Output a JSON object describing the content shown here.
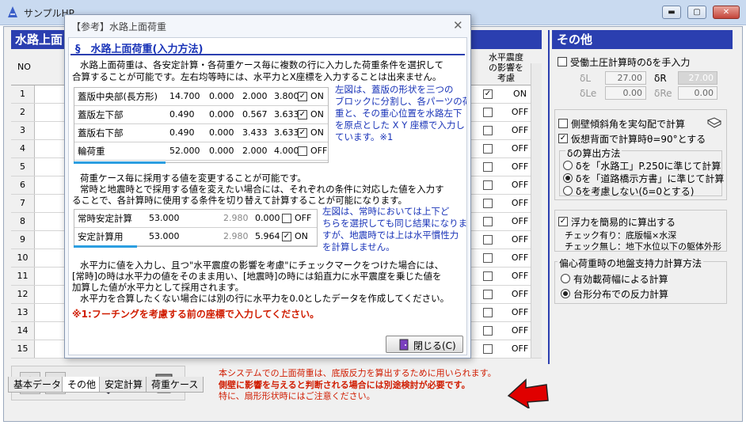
{
  "window": {
    "title": "サンプルHP"
  },
  "left_panel": {
    "title": "水路上面",
    "col_no": "NO",
    "col_seismic": "水平震度の影響を考慮",
    "rows": [
      {
        "no": "1",
        "val": "ON",
        "checked": true
      },
      {
        "no": "2",
        "val": "OFF",
        "checked": false
      },
      {
        "no": "3",
        "val": "OFF",
        "checked": false
      },
      {
        "no": "4",
        "val": "OFF",
        "checked": false
      },
      {
        "no": "5",
        "val": "OFF",
        "checked": false
      },
      {
        "no": "6",
        "val": "OFF",
        "checked": false
      },
      {
        "no": "7",
        "val": "OFF",
        "checked": false
      },
      {
        "no": "8",
        "val": "OFF",
        "checked": false
      },
      {
        "no": "9",
        "val": "OFF",
        "checked": false
      },
      {
        "no": "10",
        "val": "OFF",
        "checked": false
      },
      {
        "no": "11",
        "val": "OFF",
        "checked": false
      },
      {
        "no": "12",
        "val": "OFF",
        "checked": false
      },
      {
        "no": "13",
        "val": "OFF",
        "checked": false
      },
      {
        "no": "14",
        "val": "OFF",
        "checked": false
      },
      {
        "no": "15",
        "val": "OFF",
        "checked": false
      }
    ]
  },
  "right_panel": {
    "title": "その他",
    "active_earth": "受働土圧計算時のδを手入力",
    "dL_label": "δL",
    "dL_value": "27.00",
    "dR_label": "δR",
    "dR_value": "27.00",
    "dLe_label": "δLe",
    "dLe_value": "0.00",
    "dRe_label": "δRe",
    "dRe_value": "0.00",
    "wall_tilt": "側壁傾斜角を実勾配で計算",
    "virtual_back": "仮想背面で計算時θ=90°とする",
    "delta_method_title": "δの算出方法",
    "delta_opt1": "δを「水路工」P.250に準じて計算",
    "delta_opt2": "δを「道路橋示方書」に準じて計算",
    "delta_opt3": "δを考慮しない(δ=0とする)",
    "buoyancy": "浮力を簡易的に算出する",
    "buoyancy_note1": "チェック有り：底版幅×水深",
    "buoyancy_note2": "チェック無し：地下水位以下の躯体外形",
    "eccentric_title": "偏心荷重時の地盤支持力計算方法",
    "ecc_opt1": "有効載荷幅による計算",
    "ecc_opt2": "台形分布での反力計算"
  },
  "notice": {
    "line1": "本システムでの上面荷重は、底版反力を算出するために用いられます。",
    "line2": "側壁に影響を与えると判断される場合には別途検討が必要です。",
    "line3": "特に、扇形形状時にはご注意ください。"
  },
  "tabs": [
    "基本データ",
    "その他",
    "安定計算",
    "荷重ケース"
  ],
  "dialog": {
    "title": "【参考】水路上面荷重",
    "heading": "§　水路上面荷重(入力方法)",
    "p1a": "水路上面荷重は、各安定計算・各荷重ケース毎に複数の行に入力した荷重条件を選択して",
    "p1b": "合算することが可能です。左右均等時には、水平力とX座標を入力することは出来ません。",
    "table1": [
      {
        "name": "蓋版中央部(長方形)",
        "v1": "14.700",
        "v2": "0.000",
        "v3": "2.000",
        "v4": "3.800",
        "checked": true,
        "flag": "ON"
      },
      {
        "name": "蓋版左下部",
        "v1": "0.490",
        "v2": "0.000",
        "v3": "0.567",
        "v4": "3.633",
        "checked": true,
        "flag": "ON"
      },
      {
        "name": "蓋版右下部",
        "v1": "0.490",
        "v2": "0.000",
        "v3": "3.433",
        "v4": "3.633",
        "checked": true,
        "flag": "ON"
      },
      {
        "name": "輪荷重",
        "v1": "52.000",
        "v2": "0.000",
        "v3": "2.000",
        "v4": "4.000",
        "checked": false,
        "flag": "OFF"
      }
    ],
    "note1": [
      "左図は、蓋版の形状を三つの",
      "ブロックに分割し、各パーツの荷",
      "重と、その重心位置を水路左下",
      "を原点とした X Y 座標で入力し",
      "ています。※1"
    ],
    "p2a": "荷重ケース毎に採用する値を変更することが可能です。",
    "p2b": "常時と地震時とで採用する値を変えたい場合には、それぞれの条件に対応した値を入力す",
    "p2c": "ることで、各計算時に使用する条件を切り替えて計算することが可能になります。",
    "table2": [
      {
        "name": "常時安定計算",
        "v1": "53.000",
        "v2": "2.980",
        "v3": "0.000",
        "checked": false,
        "flag": "OFF"
      },
      {
        "name": "安定計算用",
        "v1": "53.000",
        "v2": "2.980",
        "v3": "5.964",
        "checked": true,
        "flag": "ON"
      }
    ],
    "note2": [
      "左図は、常時においては上下ど",
      "ちらを選択しても同じ結果になりま",
      "すが、地震時では上は水平慣性力",
      "を計算しません。"
    ],
    "p3a": "水平力に値を入力し、且つ\"水平震度の影響を考慮\"にチェックマークをつけた場合には、",
    "p3b": "[常時]の時は水平力の値をそのまま用い、[地震時]の時には鉛直力に水平震度を乗じた値を",
    "p3c": "加算した値が水平力として採用されます。",
    "p3d": "水平力を合算したくない場合には別の行に水平力を0.0としたデータを作成してください。",
    "footnote": "※1:フーチングを考慮する前の座標で入力してください。",
    "close_label": "閉じる(C)"
  },
  "colors": {
    "panel_head": "#2b3fb0",
    "notice_red": "#d01c00",
    "blue_note": "#1a34b8"
  }
}
